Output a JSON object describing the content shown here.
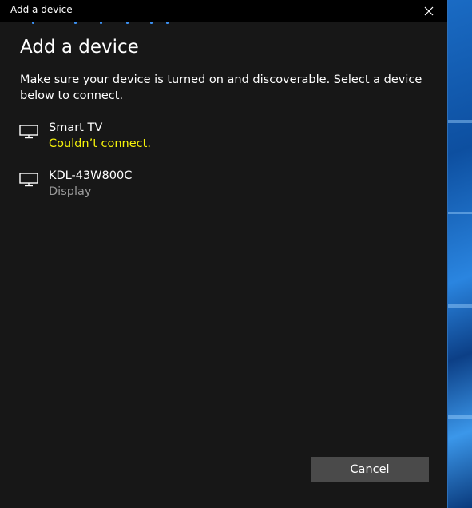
{
  "window": {
    "title": "Add a device",
    "close_icon": "close-icon"
  },
  "main": {
    "heading": "Add a device",
    "instructions": "Make sure your device is turned on and discoverable. Select a device below to connect."
  },
  "devices": [
    {
      "name": "Smart TV",
      "status": "Couldn’t connect.",
      "icon": "monitor-icon",
      "status_color": "#f6f30a"
    },
    {
      "name": "KDL-43W800C",
      "status": "Display",
      "icon": "monitor-icon",
      "status_color": "#9a9a9a"
    }
  ],
  "footer": {
    "cancel_label": "Cancel"
  },
  "colors": {
    "dialog_background": "#171717",
    "titlebar_background": "#000000",
    "accent": "#3b8ff0",
    "button_background": "#4a4a4a"
  }
}
